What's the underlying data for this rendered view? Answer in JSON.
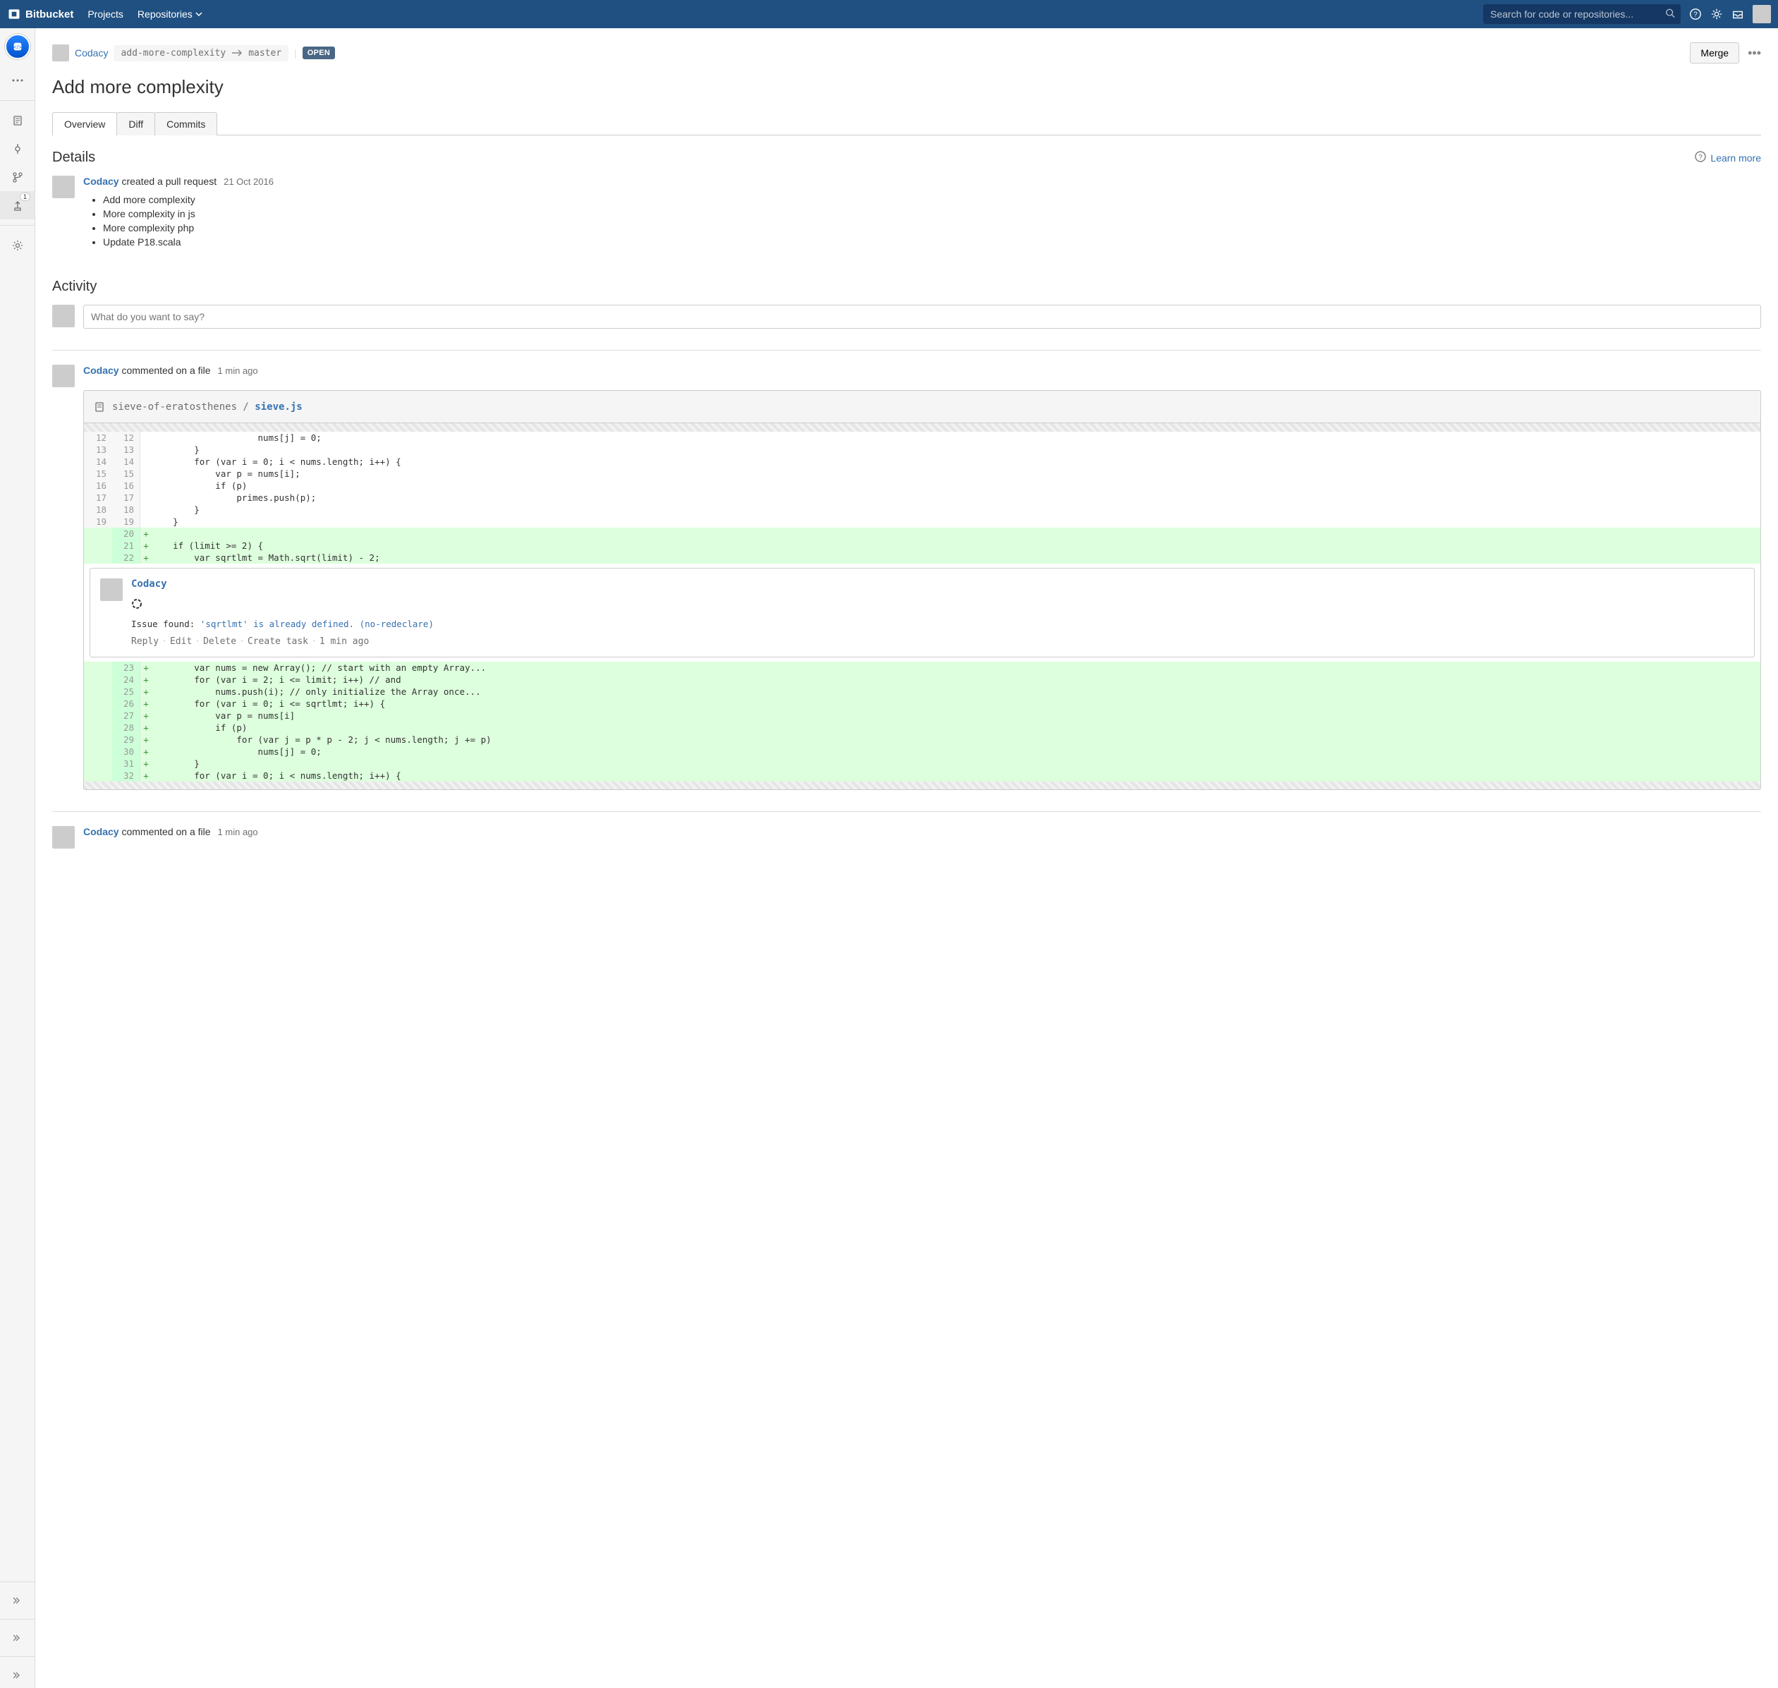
{
  "header": {
    "brand": "Bitbucket",
    "nav": {
      "projects": "Projects",
      "repositories": "Repositories"
    },
    "search_placeholder": "Search for code or repositories..."
  },
  "pr": {
    "author": "Codacy",
    "source_branch": "add-more-complexity",
    "target_branch": "master",
    "status": "OPEN",
    "merge_label": "Merge",
    "title": "Add more complexity"
  },
  "tabs": {
    "overview": "Overview",
    "diff": "Diff",
    "commits": "Commits"
  },
  "details": {
    "heading": "Details",
    "learn_more": "Learn more",
    "created_action": "created a pull request",
    "created_date": "21 Oct 2016",
    "bullets": [
      "Add more complexity",
      "More complexity in js",
      "More complexity php",
      "Update P18.scala"
    ]
  },
  "activity": {
    "heading": "Activity",
    "comment_placeholder": "What do you want to say?"
  },
  "file_comment": {
    "author": "Codacy",
    "action": "commented on a file",
    "time": "1 min ago",
    "path_prefix": "sieve-of-eratosthenes / ",
    "filename": "sieve.js",
    "diff": {
      "ctx": [
        {
          "o": "12",
          "n": "12",
          "t": "                    nums[j] = 0;"
        },
        {
          "o": "13",
          "n": "13",
          "t": "        }"
        },
        {
          "o": "14",
          "n": "14",
          "t": "        for (var i = 0; i < nums.length; i++) {"
        },
        {
          "o": "15",
          "n": "15",
          "t": "            var p = nums[i];"
        },
        {
          "o": "16",
          "n": "16",
          "t": "            if (p)"
        },
        {
          "o": "17",
          "n": "17",
          "t": "                primes.push(p);"
        },
        {
          "o": "18",
          "n": "18",
          "t": "        }"
        },
        {
          "o": "19",
          "n": "19",
          "t": "    }"
        }
      ],
      "add_before": [
        {
          "n": "20",
          "t": ""
        },
        {
          "n": "21",
          "t": "    if (limit >= 2) {"
        },
        {
          "n": "22",
          "t": "        var sqrtlmt = Math.sqrt(limit) - 2;"
        }
      ],
      "add_after": [
        {
          "n": "23",
          "t": "        var nums = new Array(); // start with an empty Array..."
        },
        {
          "n": "24",
          "t": "        for (var i = 2; i <= limit; i++) // and"
        },
        {
          "n": "25",
          "t": "            nums.push(i); // only initialize the Array once..."
        },
        {
          "n": "26",
          "t": "        for (var i = 0; i <= sqrtlmt; i++) {"
        },
        {
          "n": "27",
          "t": "            var p = nums[i]"
        },
        {
          "n": "28",
          "t": "            if (p)"
        },
        {
          "n": "29",
          "t": "                for (var j = p * p - 2; j < nums.length; j += p)"
        },
        {
          "n": "30",
          "t": "                    nums[j] = 0;"
        },
        {
          "n": "31",
          "t": "        }"
        },
        {
          "n": "32",
          "t": "        for (var i = 0; i < nums.length; i++) {"
        }
      ]
    },
    "inline": {
      "author": "Codacy",
      "issue_label": "Issue found: ",
      "issue": "'sqrtlmt' is already defined. (no-redeclare)",
      "actions": {
        "reply": "Reply",
        "edit": "Edit",
        "delete": "Delete",
        "create_task": "Create task"
      },
      "time": "1 min ago"
    }
  },
  "file_comment2": {
    "author": "Codacy",
    "action": "commented on a file",
    "time": "1 min ago"
  }
}
